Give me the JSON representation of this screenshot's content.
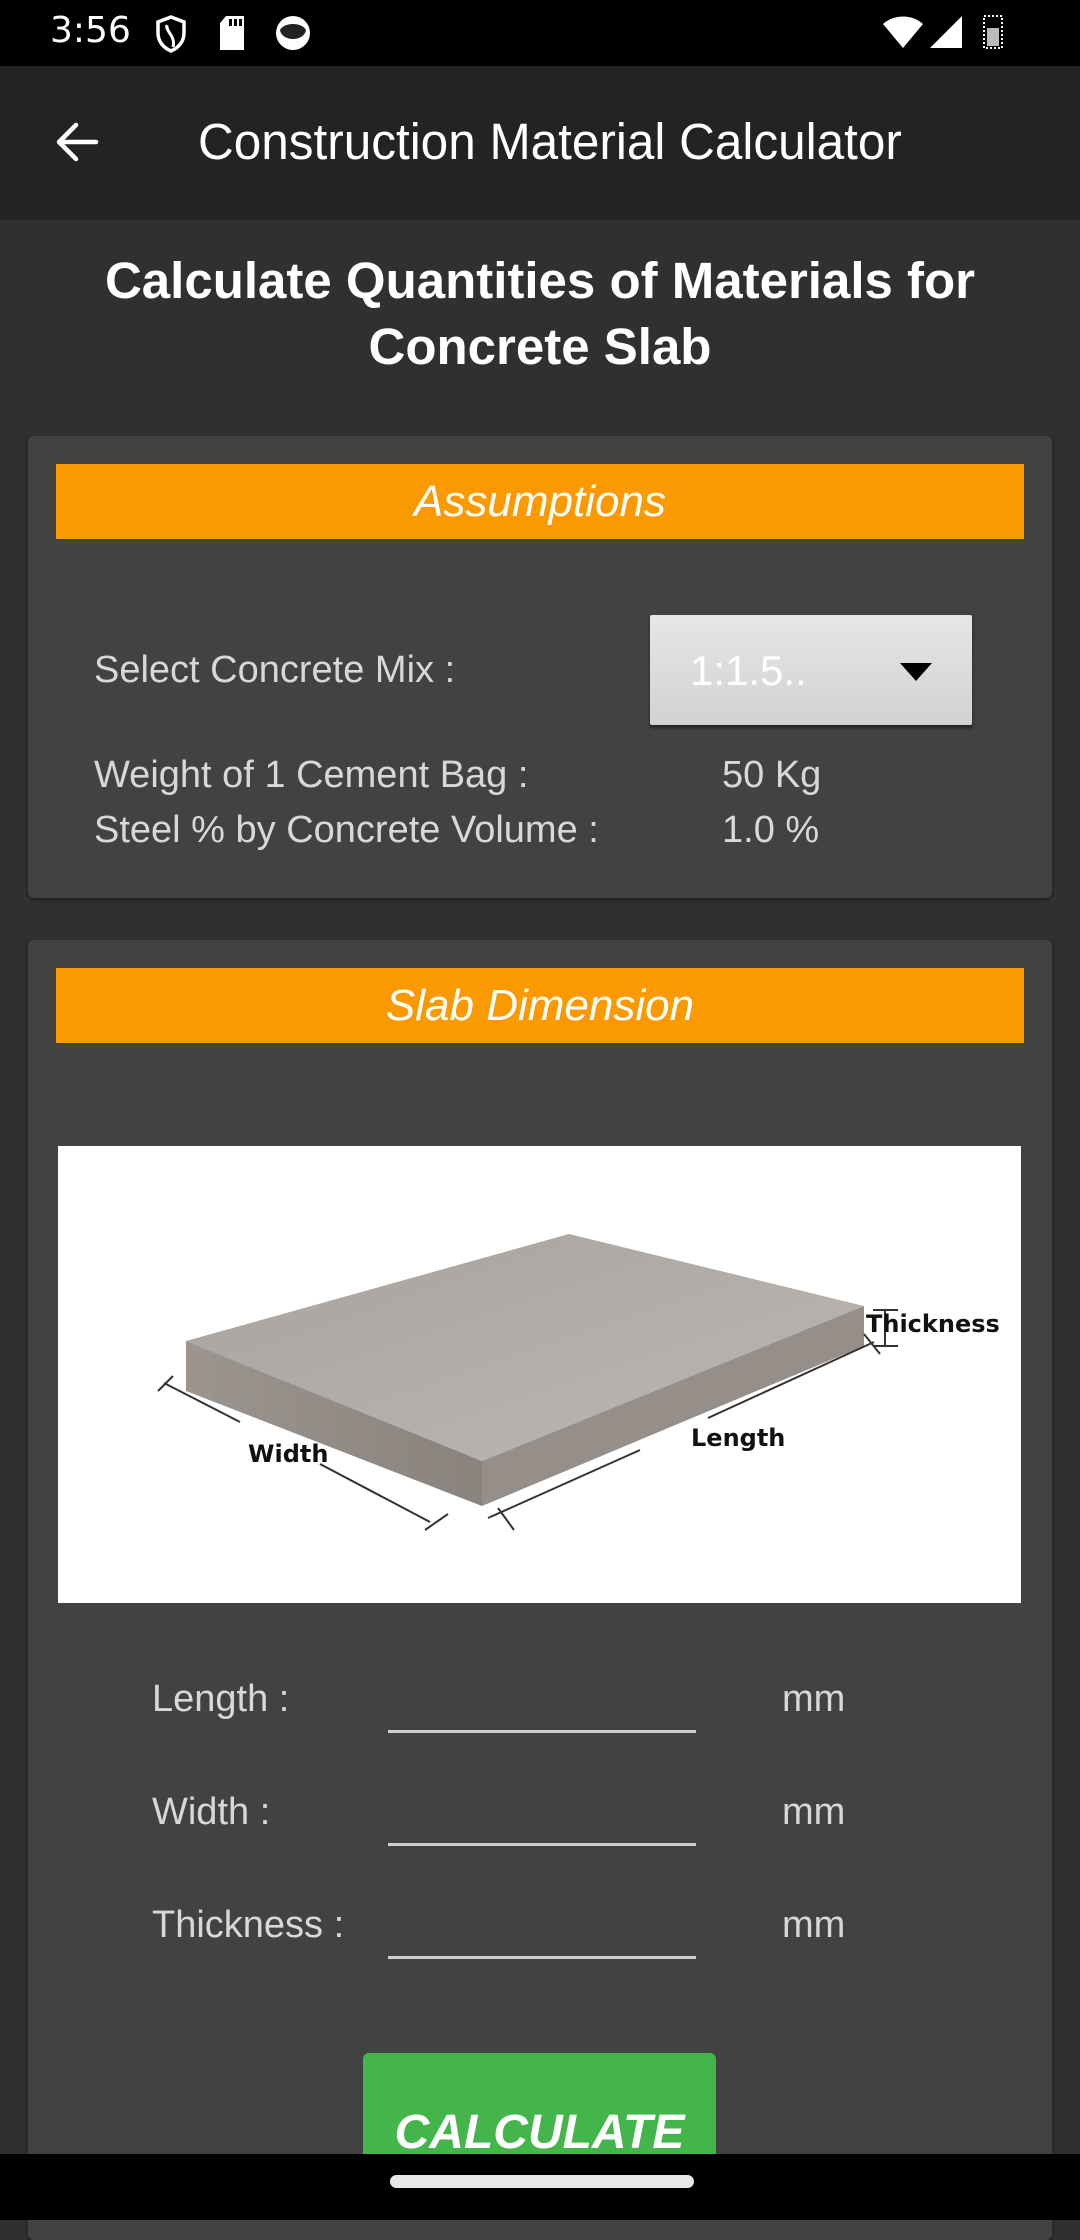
{
  "status_bar": {
    "time": "3:56",
    "left_icons": [
      "vpn-shield-icon",
      "sd-card-icon",
      "notification-app-icon"
    ],
    "right_icons": [
      "wifi-icon",
      "cellular-signal-icon",
      "battery-icon"
    ]
  },
  "app_bar": {
    "back_icon": "arrow-left-icon",
    "title": "Construction Material Calculator"
  },
  "page": {
    "heading_line1": "Calculate Quantities of Materials for",
    "heading_line2": "Concrete Slab"
  },
  "assumptions": {
    "banner": "Assumptions",
    "mix_label": "Select Concrete Mix :",
    "mix_selected": "1:1.5..",
    "cement_bag_label": "Weight of 1 Cement Bag :",
    "cement_bag_value": "50 Kg",
    "steel_label": "Steel % by Concrete Volume :",
    "steel_value": "1.0 %"
  },
  "slab_dimension": {
    "banner": "Slab Dimension",
    "diagram_labels": {
      "width": "Width",
      "length": "Length",
      "thickness": "Thickness"
    },
    "fields": [
      {
        "label": "Length :",
        "value": "",
        "unit": "mm"
      },
      {
        "label": "Width :",
        "value": "",
        "unit": "mm"
      },
      {
        "label": "Thickness :",
        "value": "",
        "unit": "mm"
      }
    ],
    "calculate_label": "CALCULATE"
  },
  "colors": {
    "banner": "#fb9900",
    "calculate": "#43b54a",
    "card": "#424242",
    "background": "#303030",
    "app_bar": "#232323"
  }
}
